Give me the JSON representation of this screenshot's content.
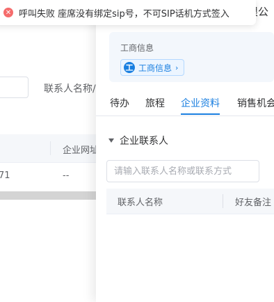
{
  "toast": {
    "message": "呼叫失败 座席没有绑定sip号，不可SIP话机方式签入",
    "icon": "error-circle-icon",
    "icon_color": "#f56c6c"
  },
  "background": {
    "field_label": "联系人名称/",
    "table": {
      "header": "企业网址",
      "row": [
        "71",
        "--"
      ]
    }
  },
  "drawer": {
    "top_text": "限公",
    "business_info": {
      "title": "工商信息",
      "tag_icon_text": "工",
      "tag_label": "工商信息",
      "tag_arrow": "›"
    },
    "tabs": [
      {
        "label": "待办",
        "active": false
      },
      {
        "label": "旅程",
        "active": false
      },
      {
        "label": "企业资料",
        "active": true
      },
      {
        "label": "销售机会",
        "active": false
      }
    ],
    "section_title": "企业联系人",
    "search_placeholder": "请输入联系人名称或联系方式",
    "contacts_table": {
      "columns": [
        "联系人名称",
        "好友备注"
      ]
    }
  },
  "colors": {
    "accent": "#1a7fe0",
    "error": "#f56c6c"
  }
}
